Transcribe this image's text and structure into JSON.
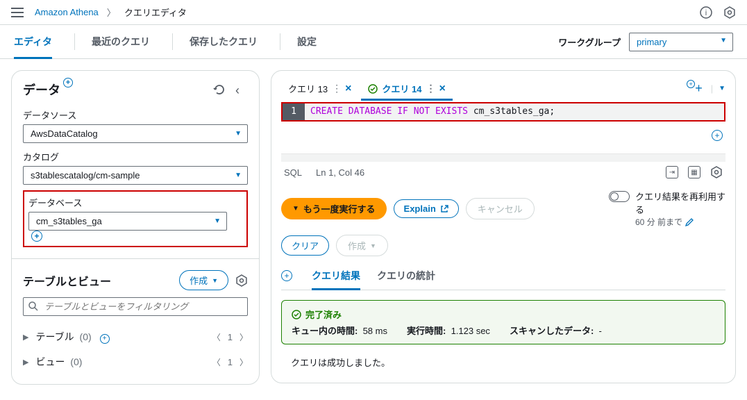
{
  "breadcrumb": {
    "service": "Amazon Athena",
    "page": "クエリエディタ"
  },
  "tabs": {
    "editor": "エディタ",
    "recent": "最近のクエリ",
    "saved": "保存したクエリ",
    "settings": "設定"
  },
  "workgroup": {
    "label": "ワークグループ",
    "value": "primary"
  },
  "sidebar": {
    "title": "データ",
    "datasource_label": "データソース",
    "datasource_value": "AwsDataCatalog",
    "catalog_label": "カタログ",
    "catalog_value": "s3tablescatalog/cm-sample",
    "database_label": "データベース",
    "database_value": "cm_s3tables_ga",
    "tables_views_title": "テーブルとビュー",
    "create_btn": "作成",
    "filter_placeholder": "テーブルとビューをフィルタリング",
    "tables_label": "テーブル",
    "tables_count": "(0)",
    "views_label": "ビュー",
    "views_count": "(0)",
    "page_num": "1"
  },
  "query_tabs": {
    "tab1": "クエリ 13",
    "tab2": "クエリ 14"
  },
  "code": {
    "line_no": "1",
    "kw1": "CREATE DATABASE IF NOT EXISTS",
    "ident": "cm_s3tables_ga;"
  },
  "status_bar": {
    "lang": "SQL",
    "pos": "Ln 1, Col 46"
  },
  "actions": {
    "run": "もう一度実行する",
    "explain": "Explain",
    "cancel": "キャンセル",
    "clear": "クリア",
    "create": "作成",
    "reuse": "クエリ結果を再利用する",
    "reuse_time": "60 分 前まで"
  },
  "results": {
    "tab_results": "クエリ結果",
    "tab_stats": "クエリの統計",
    "status": "完了済み",
    "queue_label": "キュー内の時間:",
    "queue_val": "58 ms",
    "exec_label": "実行時間:",
    "exec_val": "1.123 sec",
    "scan_label": "スキャンしたデータ:",
    "scan_val": "-",
    "success_msg": "クエリは成功しました。"
  }
}
